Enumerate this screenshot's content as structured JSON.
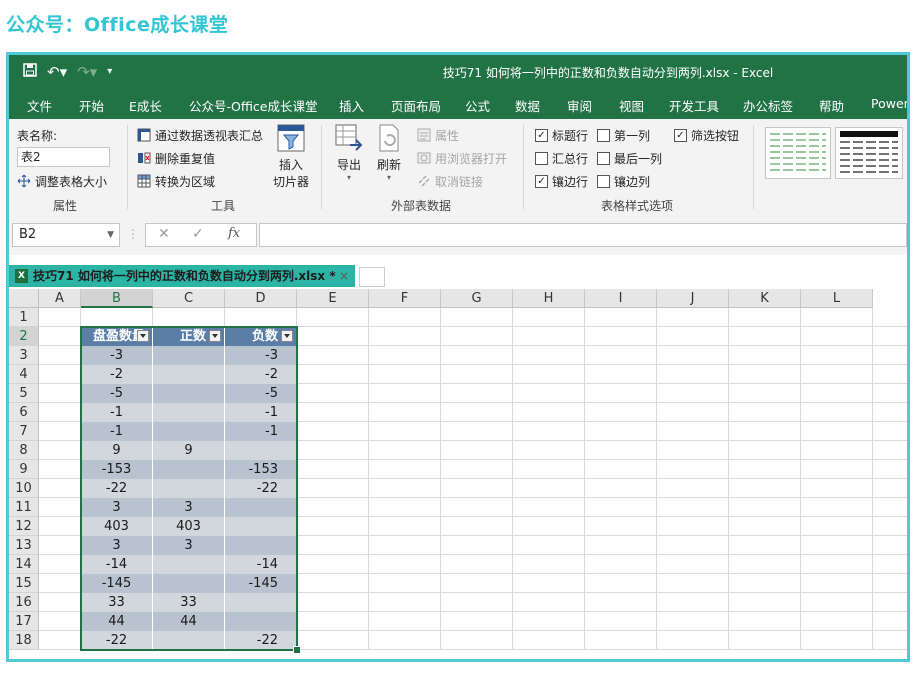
{
  "watermark": "公众号：Office成长课堂",
  "window": {
    "title": "技巧71  如何将一列中的正数和负数自动分到两列.xlsx  -  Excel",
    "qat": {
      "save": "save-icon",
      "undo": "undo-icon",
      "redo": "redo-icon",
      "customize": "customize-icon"
    }
  },
  "tabs": [
    "文件",
    "开始",
    "E成长",
    "公众号-Office成长课堂",
    "插入",
    "页面布局",
    "公式",
    "数据",
    "审阅",
    "视图",
    "开发工具",
    "办公标签",
    "帮助",
    "Power"
  ],
  "ribbon": {
    "properties": {
      "table_name_label": "表名称:",
      "table_name_value": "表2",
      "resize_label": "调整表格大小",
      "group": "属性"
    },
    "tools": {
      "pivot": "通过数据透视表汇总",
      "remove_dup": "删除重复值",
      "convert": "转换为区域",
      "slicer_line1": "插入",
      "slicer_line2": "切片器",
      "group": "工具"
    },
    "external": {
      "export": "导出",
      "refresh": "刷新",
      "properties": "属性",
      "open_browser": "用浏览器打开",
      "unlink": "取消链接",
      "group": "外部表数据"
    },
    "style_options": {
      "header_row": "标题行",
      "header_row_checked": true,
      "first_col": "第一列",
      "first_col_checked": false,
      "filter_btn": "筛选按钮",
      "filter_btn_checked": true,
      "total_row": "汇总行",
      "total_row_checked": false,
      "last_col": "最后一列",
      "last_col_checked": false,
      "banded_rows": "镶边行",
      "banded_rows_checked": true,
      "banded_cols": "镶边列",
      "banded_cols_checked": false,
      "group": "表格样式选项"
    }
  },
  "formula_bar": {
    "name_box": "B2",
    "cancel": "✕",
    "enter": "✓",
    "fx": "fx",
    "formula": ""
  },
  "doc_tab": {
    "title": "技巧71  如何将一列中的正数和负数自动分到两列.xlsx *",
    "close": "×"
  },
  "columns": [
    "A",
    "B",
    "C",
    "D",
    "E",
    "F",
    "G",
    "H",
    "I",
    "J",
    "K",
    "L"
  ],
  "rows": [
    "1",
    "2",
    "3",
    "4",
    "5",
    "6",
    "7",
    "8",
    "9",
    "10",
    "11",
    "12",
    "13",
    "14",
    "15",
    "16",
    "17",
    "18"
  ],
  "table": {
    "headers": [
      "盘盈数量",
      "正数",
      "负数"
    ],
    "data": [
      [
        "-3",
        "",
        "-3"
      ],
      [
        "-2",
        "",
        "-2"
      ],
      [
        "-5",
        "",
        "-5"
      ],
      [
        "-1",
        "",
        "-1"
      ],
      [
        "-1",
        "",
        "-1"
      ],
      [
        "9",
        "9",
        ""
      ],
      [
        "-153",
        "",
        "-153"
      ],
      [
        "-22",
        "",
        "-22"
      ],
      [
        "3",
        "3",
        ""
      ],
      [
        "403",
        "403",
        ""
      ],
      [
        "3",
        "3",
        ""
      ],
      [
        "-14",
        "",
        "-14"
      ],
      [
        "-145",
        "",
        "-145"
      ],
      [
        "33",
        "33",
        ""
      ],
      [
        "44",
        "44",
        ""
      ],
      [
        "-22",
        "",
        "-22"
      ]
    ],
    "band_colors": [
      "#b9c3cf",
      "#d2d7dd"
    ],
    "header_color": "#5b7ea6"
  }
}
